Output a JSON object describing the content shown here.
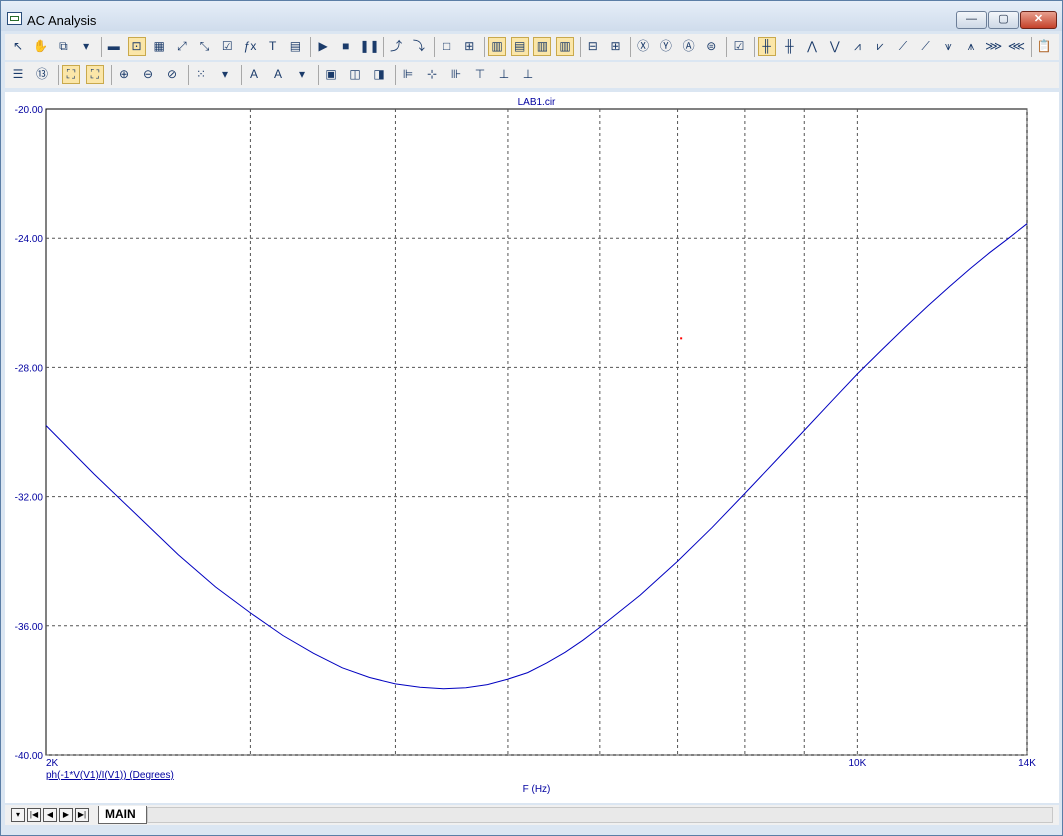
{
  "window": {
    "title": "AC Analysis"
  },
  "titlebar_buttons": {
    "minimize": "—",
    "maximize": "▢",
    "close": "✕"
  },
  "toolbar_row1": [
    {
      "name": "select-arrow-icon",
      "glyph": "↖"
    },
    {
      "name": "hand-pan-icon",
      "glyph": "✋"
    },
    {
      "name": "copy-icon",
      "glyph": "⧉"
    },
    {
      "name": "dropdown-arrow-icon",
      "glyph": "▾"
    },
    {
      "name": "graph-window-icon",
      "glyph": "▬"
    },
    {
      "name": "scale-icon",
      "glyph": "⊡",
      "on": true
    },
    {
      "name": "zoom-region-icon",
      "glyph": "▦"
    },
    {
      "name": "fit-horizontal-icon",
      "glyph": "⤢"
    },
    {
      "name": "fit-vertical-icon",
      "glyph": "⤡"
    },
    {
      "name": "curve-check-icon",
      "glyph": "☑"
    },
    {
      "name": "function-icon",
      "glyph": "ƒx"
    },
    {
      "name": "text-tool-icon",
      "glyph": "T"
    },
    {
      "name": "properties-icon",
      "glyph": "▤"
    },
    {
      "name": "run-icon",
      "glyph": "▶"
    },
    {
      "name": "stop-icon",
      "glyph": "■"
    },
    {
      "name": "pause-icon",
      "glyph": "❚❚"
    },
    {
      "name": "peak-icon",
      "glyph": "⤴"
    },
    {
      "name": "valley-icon",
      "glyph": "⤵"
    },
    {
      "name": "box-icon",
      "glyph": "□"
    },
    {
      "name": "grid-dots-icon",
      "glyph": "⊞"
    },
    {
      "name": "tile-vertical-icon",
      "glyph": "▥",
      "on": true
    },
    {
      "name": "tile-horizontal-icon",
      "glyph": "▤",
      "on": true
    },
    {
      "name": "tile-left-icon",
      "glyph": "▥",
      "on": true
    },
    {
      "name": "tile-right-icon",
      "glyph": "▥",
      "on": true
    },
    {
      "name": "split-horizontal-icon",
      "glyph": "⊟"
    },
    {
      "name": "split-grid-icon",
      "glyph": "⊞"
    },
    {
      "name": "zoom-x-icon",
      "glyph": "Ⓧ"
    },
    {
      "name": "zoom-y-icon",
      "glyph": "Ⓨ"
    },
    {
      "name": "zoom-a-icon",
      "glyph": "Ⓐ"
    },
    {
      "name": "zoom-list-icon",
      "glyph": "⊜"
    },
    {
      "name": "settings-check-icon",
      "glyph": "☑"
    },
    {
      "name": "cursor-left-icon",
      "glyph": "╫",
      "on": true
    },
    {
      "name": "cursor-right-icon",
      "glyph": "╫"
    },
    {
      "name": "peak-search-icon",
      "glyph": "⋀"
    },
    {
      "name": "valley-search-icon",
      "glyph": "⋁"
    },
    {
      "name": "high-icon",
      "glyph": "⩘"
    },
    {
      "name": "low-icon",
      "glyph": "⩗"
    },
    {
      "name": "inflection-icon",
      "glyph": "⟋"
    },
    {
      "name": "slope-icon",
      "glyph": "⟋"
    },
    {
      "name": "global-high-icon",
      "glyph": "⩛"
    },
    {
      "name": "global-low-icon",
      "glyph": "⩚"
    },
    {
      "name": "top-icon",
      "glyph": "⋙"
    },
    {
      "name": "bottom-icon",
      "glyph": "⋘"
    },
    {
      "name": "clipboard-icon",
      "glyph": "📋"
    },
    {
      "name": "clipboard-dropdown-icon",
      "glyph": "▾"
    }
  ],
  "toolbar_row2": [
    {
      "name": "list-icon",
      "glyph": "☰"
    },
    {
      "name": "data-points-icon",
      "glyph": "⑬"
    },
    {
      "name": "fit-all-icon",
      "glyph": "⛶",
      "on": true
    },
    {
      "name": "fit-y-icon",
      "glyph": "⛶",
      "on": true
    },
    {
      "name": "zoom-in-icon",
      "glyph": "⊕"
    },
    {
      "name": "zoom-out-icon",
      "glyph": "⊖"
    },
    {
      "name": "zoom-100-icon",
      "glyph": "⊘"
    },
    {
      "name": "grid-icon",
      "glyph": "⁙"
    },
    {
      "name": "grid-dropdown-icon",
      "glyph": "▾"
    },
    {
      "name": "font-icon",
      "glyph": "A"
    },
    {
      "name": "font-size-icon",
      "glyph": "A"
    },
    {
      "name": "font-dropdown-icon",
      "glyph": "▾"
    },
    {
      "name": "bring-front-icon",
      "glyph": "▣"
    },
    {
      "name": "send-back-icon",
      "glyph": "◫"
    },
    {
      "name": "group-icon",
      "glyph": "◨"
    },
    {
      "name": "align-left-icon",
      "glyph": "⊫"
    },
    {
      "name": "align-center-icon",
      "glyph": "⊹"
    },
    {
      "name": "align-right-icon",
      "glyph": "⊪"
    },
    {
      "name": "align-top-icon",
      "glyph": "⊤"
    },
    {
      "name": "align-middle-icon",
      "glyph": "⊥"
    },
    {
      "name": "align-bottom-icon",
      "glyph": "⊥"
    }
  ],
  "tabs": {
    "active": "MAIN"
  },
  "chart_data": {
    "type": "line",
    "title": "LAB1.cir",
    "xlabel": "F (Hz)",
    "x_scale": "log",
    "xlim": [
      2000,
      14000
    ],
    "ylim": [
      -40,
      -20
    ],
    "x_ticks": [
      {
        "value": 2000,
        "label": "2K"
      },
      {
        "value": 10000,
        "label": "10K"
      },
      {
        "value": 14000,
        "label": "14K"
      }
    ],
    "y_ticks": [
      {
        "value": -20,
        "label": "-20.00"
      },
      {
        "value": -24,
        "label": "-24.00"
      },
      {
        "value": -28,
        "label": "-28.00"
      },
      {
        "value": -32,
        "label": "-32.00"
      },
      {
        "value": -36,
        "label": "-36.00"
      },
      {
        "value": -40,
        "label": "-40.00"
      }
    ],
    "grid_x": [
      3000,
      4000,
      5000,
      6000,
      7000,
      8000,
      9000,
      10000,
      14000
    ],
    "grid_y": [
      -24,
      -28,
      -32,
      -36,
      -40
    ],
    "grid": true,
    "series": [
      {
        "name": "ph(-1*V(V1)/I(V1)) (Degrees)",
        "color": "#0000c0",
        "x": [
          2000,
          2200,
          2400,
          2600,
          2800,
          3000,
          3200,
          3400,
          3600,
          3800,
          4000,
          4200,
          4400,
          4600,
          4800,
          5000,
          5200,
          5400,
          5600,
          5800,
          6000,
          6500,
          7000,
          7500,
          8000,
          8500,
          9000,
          9500,
          10000,
          10500,
          11000,
          11500,
          12000,
          12500,
          13000,
          13500,
          14000
        ],
        "y": [
          -29.8,
          -31.3,
          -32.6,
          -33.8,
          -34.8,
          -35.6,
          -36.3,
          -36.85,
          -37.3,
          -37.6,
          -37.8,
          -37.9,
          -37.95,
          -37.92,
          -37.82,
          -37.65,
          -37.45,
          -37.15,
          -36.82,
          -36.45,
          -36.05,
          -35.05,
          -34.0,
          -32.95,
          -31.9,
          -30.9,
          -29.95,
          -29.05,
          -28.2,
          -27.45,
          -26.75,
          -26.1,
          -25.5,
          -24.95,
          -24.45,
          -24.0,
          -23.55
        ]
      }
    ],
    "cursor_marker": {
      "x": 7050,
      "y": -27.1,
      "color": "#ff0000"
    }
  }
}
